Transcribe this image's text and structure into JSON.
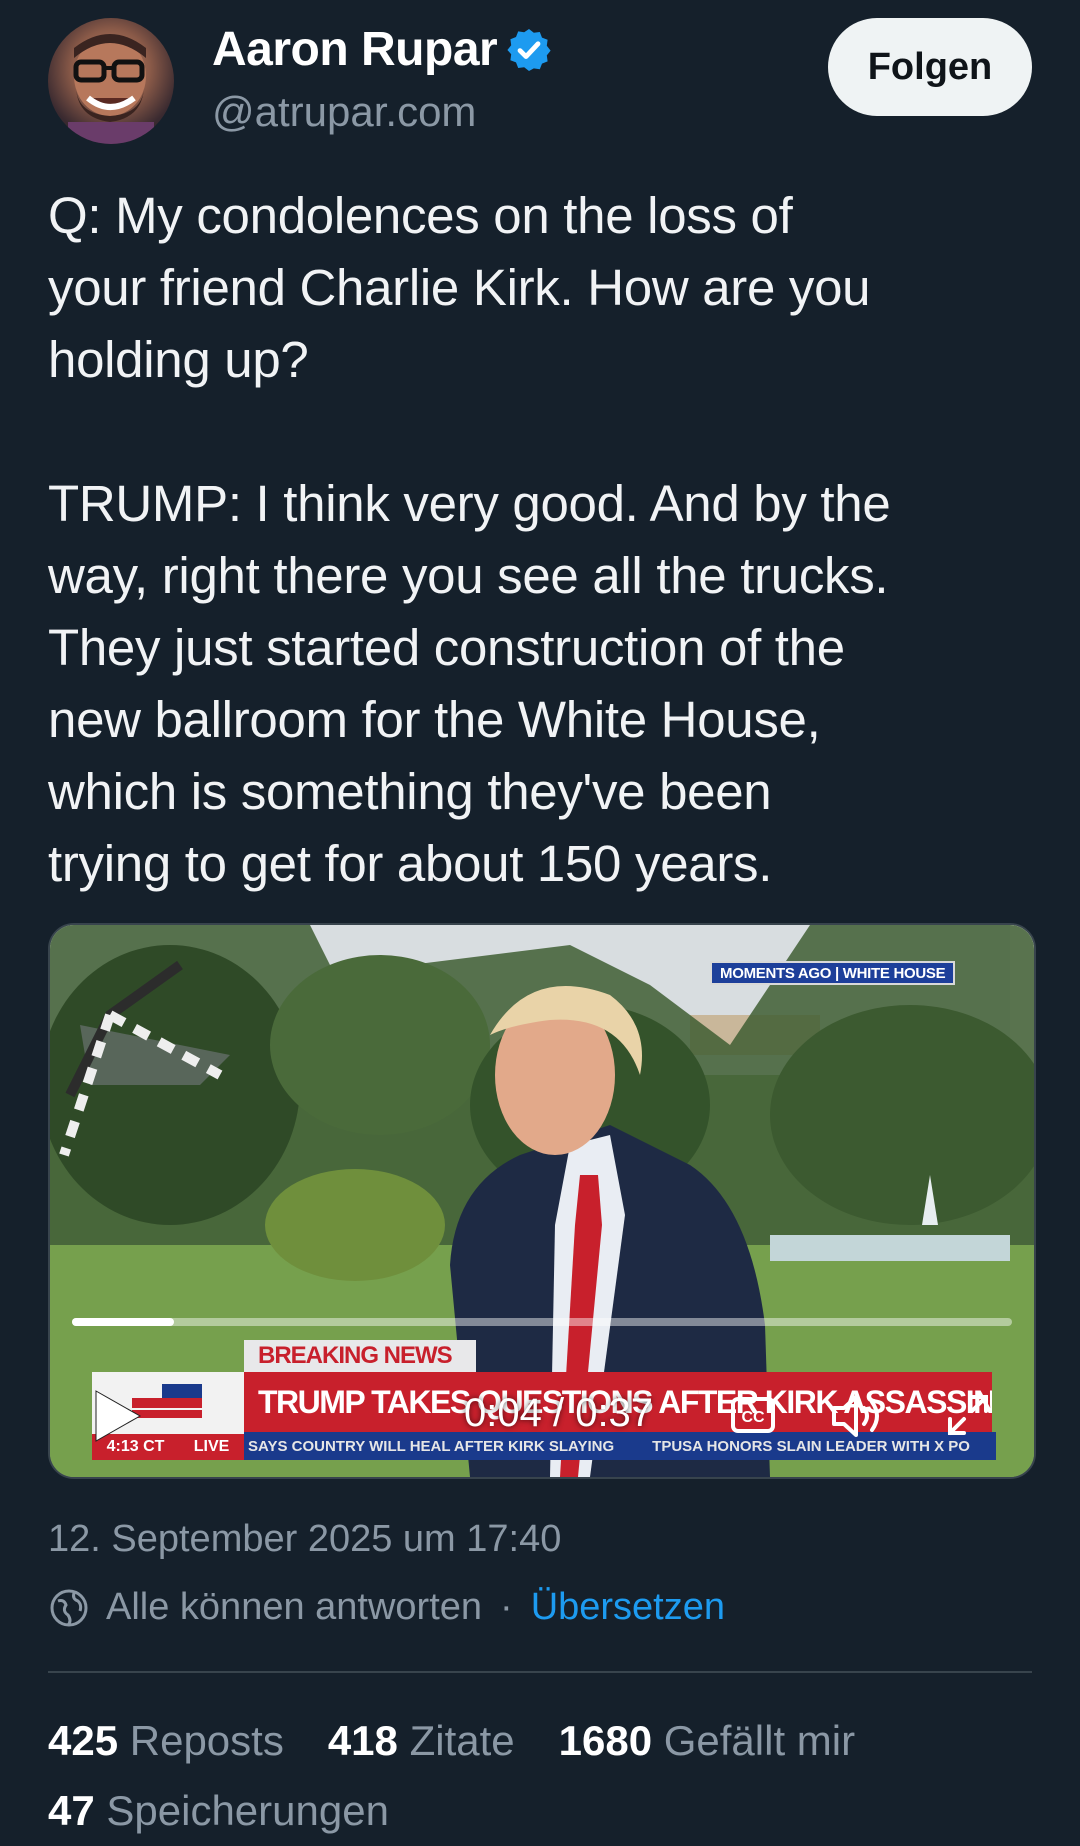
{
  "author": {
    "name": "Aaron Rupar",
    "handle": "@atrupar.com",
    "verified": true
  },
  "follow_button": {
    "label": "Folgen"
  },
  "tweet": {
    "text": "Q: My condolences on the loss of\nyour friend Charlie Kirk. How are you\nholding up?\n\nTRUMP: I think very good. And by the\nway, right there you see all the trucks.\nThey just started construction of the\nnew ballroom for the White House,\nwhich is something they've been\ntrying to get for about 150 years."
  },
  "video": {
    "badge": "MOMENTS AGO | WHITE HOUSE",
    "breaking_label": "BREAKING NEWS",
    "headline": "TRUMP TAKES QUESTIONS AFTER KIRK ASSASSINATION",
    "local_time": "4:13 CT",
    "live_label": "LIVE",
    "ticker": [
      "SAYS COUNTRY WILL HEAL AFTER KIRK SLAYING",
      "TPUSA HONORS SLAIN LEADER WITH X PO"
    ],
    "time_display": "0:04 / 0:37",
    "progress_fraction": 0.108,
    "icons": [
      "play-icon",
      "closed-captions-icon",
      "volume-icon",
      "fullscreen-icon"
    ]
  },
  "meta": {
    "timestamp": "12. September 2025 um 17:40",
    "reply_setting": "Alle können antworten",
    "separator": "·",
    "translate_label": "Übersetzen"
  },
  "stats": [
    {
      "count": "425",
      "label": "Reposts"
    },
    {
      "count": "418",
      "label": "Zitate"
    },
    {
      "count": "1680",
      "label": "Gefällt mir"
    },
    {
      "count": "47",
      "label": "Speicherungen"
    }
  ],
  "colors": {
    "background": "#15202b",
    "secondary_text": "#8b98a5",
    "link": "#1d9bf0",
    "verified": "#1d9bf0",
    "follow_button_bg": "#eff3f4"
  }
}
